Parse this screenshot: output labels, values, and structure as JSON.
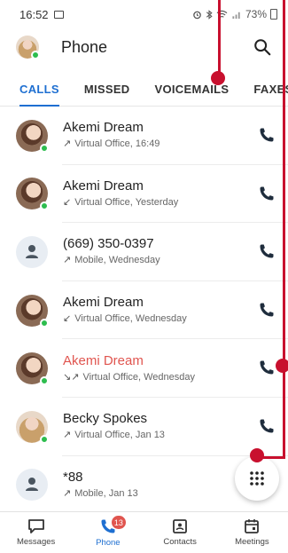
{
  "status_bar": {
    "time": "16:52",
    "battery": "73%"
  },
  "header": {
    "title": "Phone"
  },
  "tabs": [
    {
      "label": "CALLS",
      "active": true
    },
    {
      "label": "MISSED",
      "active": false
    },
    {
      "label": "VOICEMAILS",
      "active": false
    },
    {
      "label": "FAXES",
      "active": false
    }
  ],
  "calls": [
    {
      "name": "Akemi Dream",
      "direction": "outgoing",
      "detail": "Virtual Office, 16:49",
      "avatar": "photo",
      "missed": false
    },
    {
      "name": "Akemi Dream",
      "direction": "incoming",
      "detail": "Virtual Office, Yesterday",
      "avatar": "photo",
      "missed": false
    },
    {
      "name": "(669) 350-0397",
      "direction": "outgoing",
      "detail": "Mobile, Wednesday",
      "avatar": "generic",
      "missed": false
    },
    {
      "name": "Akemi Dream",
      "direction": "incoming",
      "detail": "Virtual Office, Wednesday",
      "avatar": "photo",
      "missed": false
    },
    {
      "name": "Akemi Dream",
      "direction": "missed",
      "detail": "Virtual Office, Wednesday",
      "avatar": "photo",
      "missed": true
    },
    {
      "name": "Becky Spokes",
      "direction": "outgoing",
      "detail": "Virtual Office, Jan 13",
      "avatar": "photo2",
      "missed": false
    },
    {
      "name": "*88",
      "direction": "outgoing",
      "detail": "Mobile, Jan 13",
      "avatar": "generic",
      "missed": false
    }
  ],
  "bottom_nav": [
    {
      "label": "Messages",
      "icon": "message-icon",
      "active": false
    },
    {
      "label": "Phone",
      "icon": "phone-icon",
      "active": true,
      "badge": "13"
    },
    {
      "label": "Contacts",
      "icon": "contacts-icon",
      "active": false
    },
    {
      "label": "Meetings",
      "icon": "calendar-icon",
      "active": false
    }
  ],
  "colors": {
    "accent": "#1e6fd1",
    "missed": "#e0554f",
    "online": "#2dbd4e",
    "annotation": "#c8102e"
  }
}
